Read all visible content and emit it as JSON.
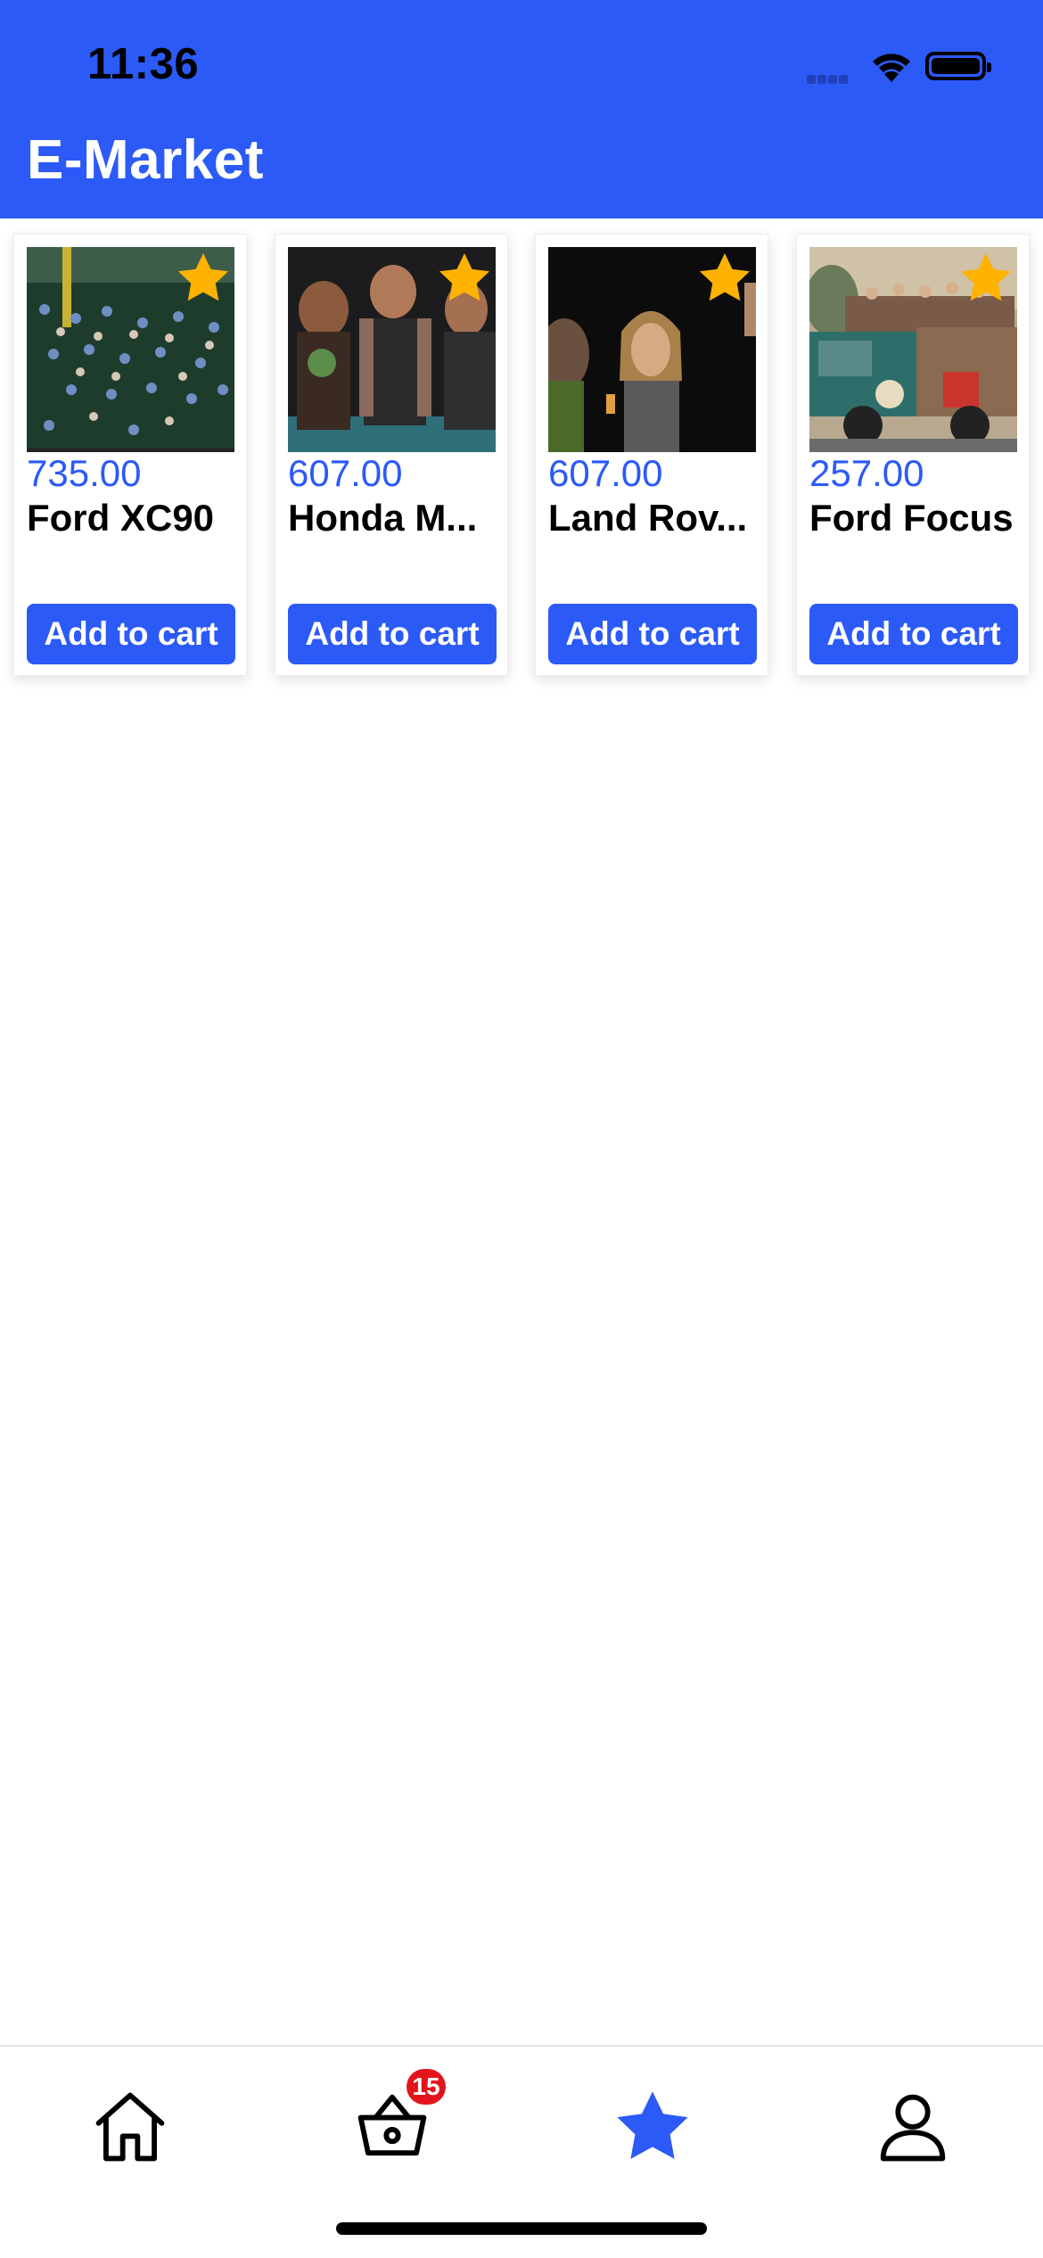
{
  "status_bar": {
    "time": "11:36"
  },
  "header": {
    "title": "E-Market",
    "background": "#2c5af6"
  },
  "products": [
    {
      "price": "735.00",
      "name": "Ford XC90",
      "button": "Add to cart",
      "favorite": true
    },
    {
      "price": "607.00",
      "name": "Honda M...",
      "button": "Add to cart",
      "favorite": true
    },
    {
      "price": "607.00",
      "name": "Land Rov...",
      "button": "Add to cart",
      "favorite": true
    },
    {
      "price": "257.00",
      "name": "Ford Focus",
      "button": "Add to cart",
      "favorite": true
    }
  ],
  "tabbar": {
    "tabs": [
      {
        "icon": "home-icon",
        "active": false
      },
      {
        "icon": "basket-icon",
        "active": false,
        "badge": "15"
      },
      {
        "icon": "star-icon",
        "active": true
      },
      {
        "icon": "profile-icon",
        "active": false
      }
    ]
  },
  "colors": {
    "accent": "#2c5af6",
    "star": "#ffb300",
    "badge": "#e3141b"
  }
}
